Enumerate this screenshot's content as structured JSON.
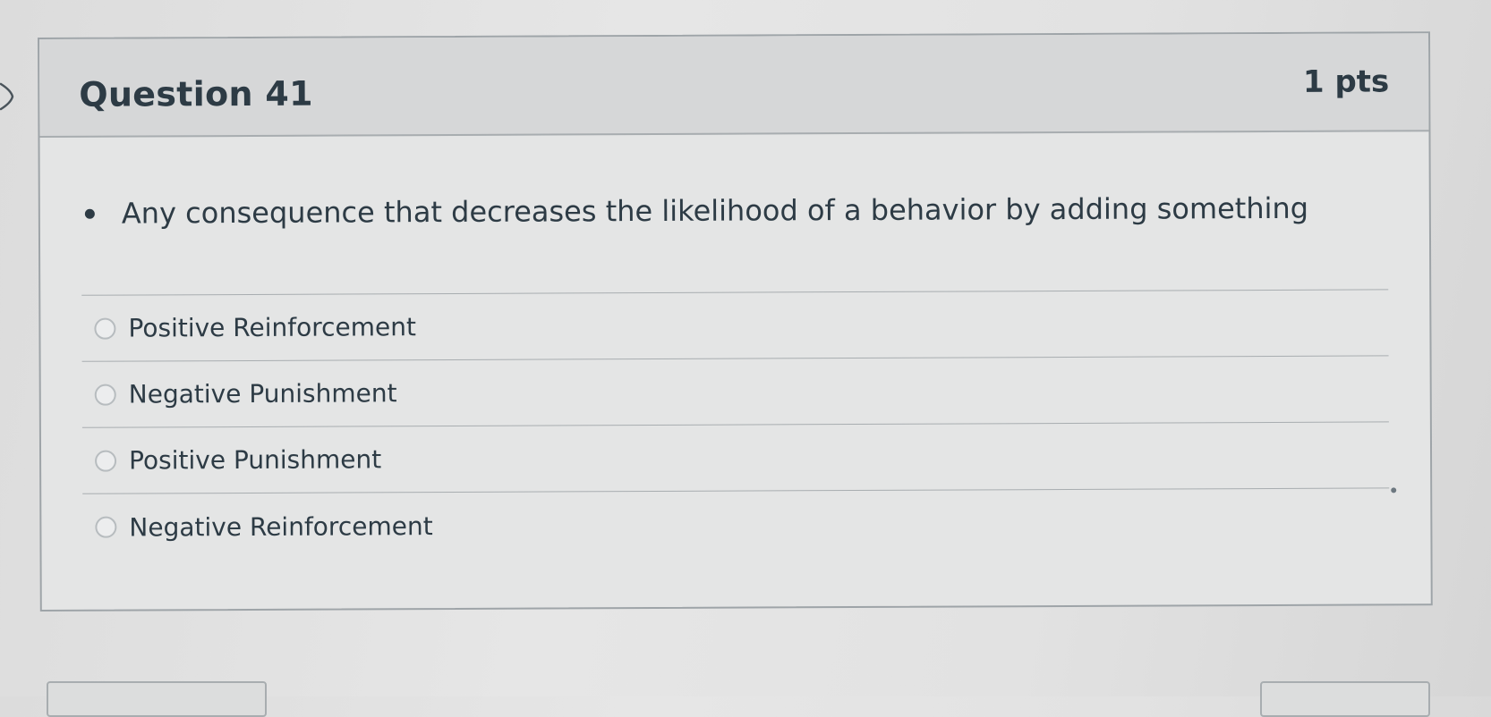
{
  "question": {
    "title": "Question 41",
    "points": "1 pts",
    "prompt": "Any consequence that decreases the likelihood of a behavior by adding something"
  },
  "answers": [
    {
      "label": "Positive Reinforcement",
      "selected": false
    },
    {
      "label": "Negative Punishment",
      "selected": false
    },
    {
      "label": "Positive Punishment",
      "selected": false
    },
    {
      "label": "Negative Reinforcement",
      "selected": false
    }
  ],
  "icons": {
    "collapse": "chevron-right-icon",
    "bullet": "bullet-icon"
  },
  "colors": {
    "text": "#2d3b45",
    "header_bg": "#d6d7d8",
    "border": "#9ea4a8"
  }
}
